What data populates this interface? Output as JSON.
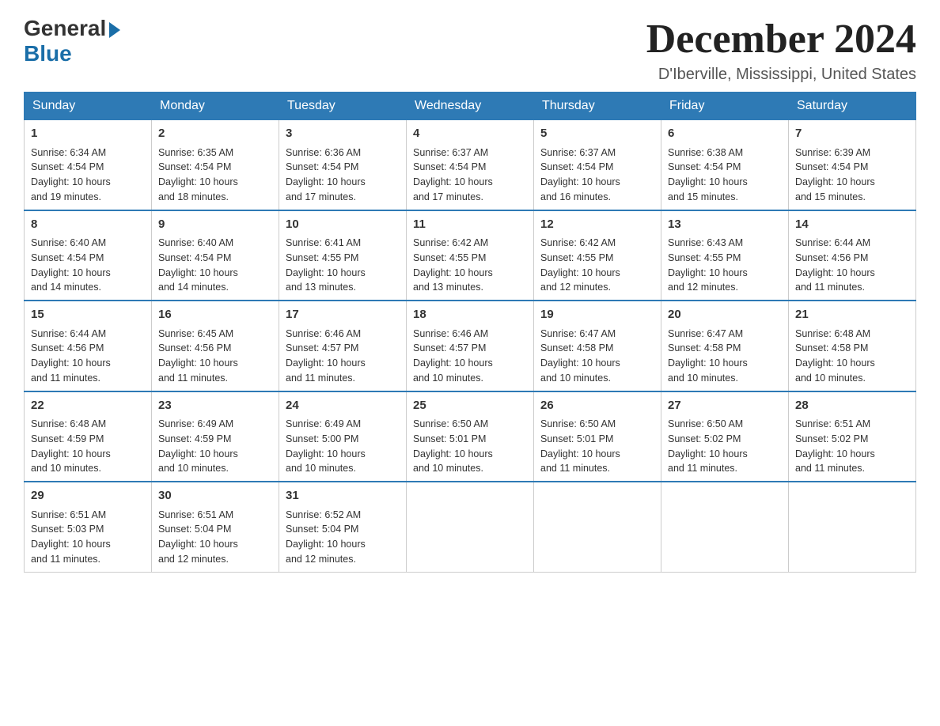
{
  "logo": {
    "general": "General",
    "blue": "Blue"
  },
  "header": {
    "month": "December 2024",
    "location": "D'Iberville, Mississippi, United States"
  },
  "weekdays": [
    "Sunday",
    "Monday",
    "Tuesday",
    "Wednesday",
    "Thursday",
    "Friday",
    "Saturday"
  ],
  "weeks": [
    [
      {
        "day": "1",
        "sunrise": "6:34 AM",
        "sunset": "4:54 PM",
        "daylight": "10 hours and 19 minutes."
      },
      {
        "day": "2",
        "sunrise": "6:35 AM",
        "sunset": "4:54 PM",
        "daylight": "10 hours and 18 minutes."
      },
      {
        "day": "3",
        "sunrise": "6:36 AM",
        "sunset": "4:54 PM",
        "daylight": "10 hours and 17 minutes."
      },
      {
        "day": "4",
        "sunrise": "6:37 AM",
        "sunset": "4:54 PM",
        "daylight": "10 hours and 17 minutes."
      },
      {
        "day": "5",
        "sunrise": "6:37 AM",
        "sunset": "4:54 PM",
        "daylight": "10 hours and 16 minutes."
      },
      {
        "day": "6",
        "sunrise": "6:38 AM",
        "sunset": "4:54 PM",
        "daylight": "10 hours and 15 minutes."
      },
      {
        "day": "7",
        "sunrise": "6:39 AM",
        "sunset": "4:54 PM",
        "daylight": "10 hours and 15 minutes."
      }
    ],
    [
      {
        "day": "8",
        "sunrise": "6:40 AM",
        "sunset": "4:54 PM",
        "daylight": "10 hours and 14 minutes."
      },
      {
        "day": "9",
        "sunrise": "6:40 AM",
        "sunset": "4:54 PM",
        "daylight": "10 hours and 14 minutes."
      },
      {
        "day": "10",
        "sunrise": "6:41 AM",
        "sunset": "4:55 PM",
        "daylight": "10 hours and 13 minutes."
      },
      {
        "day": "11",
        "sunrise": "6:42 AM",
        "sunset": "4:55 PM",
        "daylight": "10 hours and 13 minutes."
      },
      {
        "day": "12",
        "sunrise": "6:42 AM",
        "sunset": "4:55 PM",
        "daylight": "10 hours and 12 minutes."
      },
      {
        "day": "13",
        "sunrise": "6:43 AM",
        "sunset": "4:55 PM",
        "daylight": "10 hours and 12 minutes."
      },
      {
        "day": "14",
        "sunrise": "6:44 AM",
        "sunset": "4:56 PM",
        "daylight": "10 hours and 11 minutes."
      }
    ],
    [
      {
        "day": "15",
        "sunrise": "6:44 AM",
        "sunset": "4:56 PM",
        "daylight": "10 hours and 11 minutes."
      },
      {
        "day": "16",
        "sunrise": "6:45 AM",
        "sunset": "4:56 PM",
        "daylight": "10 hours and 11 minutes."
      },
      {
        "day": "17",
        "sunrise": "6:46 AM",
        "sunset": "4:57 PM",
        "daylight": "10 hours and 11 minutes."
      },
      {
        "day": "18",
        "sunrise": "6:46 AM",
        "sunset": "4:57 PM",
        "daylight": "10 hours and 10 minutes."
      },
      {
        "day": "19",
        "sunrise": "6:47 AM",
        "sunset": "4:58 PM",
        "daylight": "10 hours and 10 minutes."
      },
      {
        "day": "20",
        "sunrise": "6:47 AM",
        "sunset": "4:58 PM",
        "daylight": "10 hours and 10 minutes."
      },
      {
        "day": "21",
        "sunrise": "6:48 AM",
        "sunset": "4:58 PM",
        "daylight": "10 hours and 10 minutes."
      }
    ],
    [
      {
        "day": "22",
        "sunrise": "6:48 AM",
        "sunset": "4:59 PM",
        "daylight": "10 hours and 10 minutes."
      },
      {
        "day": "23",
        "sunrise": "6:49 AM",
        "sunset": "4:59 PM",
        "daylight": "10 hours and 10 minutes."
      },
      {
        "day": "24",
        "sunrise": "6:49 AM",
        "sunset": "5:00 PM",
        "daylight": "10 hours and 10 minutes."
      },
      {
        "day": "25",
        "sunrise": "6:50 AM",
        "sunset": "5:01 PM",
        "daylight": "10 hours and 10 minutes."
      },
      {
        "day": "26",
        "sunrise": "6:50 AM",
        "sunset": "5:01 PM",
        "daylight": "10 hours and 11 minutes."
      },
      {
        "day": "27",
        "sunrise": "6:50 AM",
        "sunset": "5:02 PM",
        "daylight": "10 hours and 11 minutes."
      },
      {
        "day": "28",
        "sunrise": "6:51 AM",
        "sunset": "5:02 PM",
        "daylight": "10 hours and 11 minutes."
      }
    ],
    [
      {
        "day": "29",
        "sunrise": "6:51 AM",
        "sunset": "5:03 PM",
        "daylight": "10 hours and 11 minutes."
      },
      {
        "day": "30",
        "sunrise": "6:51 AM",
        "sunset": "5:04 PM",
        "daylight": "10 hours and 12 minutes."
      },
      {
        "day": "31",
        "sunrise": "6:52 AM",
        "sunset": "5:04 PM",
        "daylight": "10 hours and 12 minutes."
      },
      null,
      null,
      null,
      null
    ]
  ],
  "labels": {
    "sunrise": "Sunrise:",
    "sunset": "Sunset:",
    "daylight": "Daylight:"
  }
}
